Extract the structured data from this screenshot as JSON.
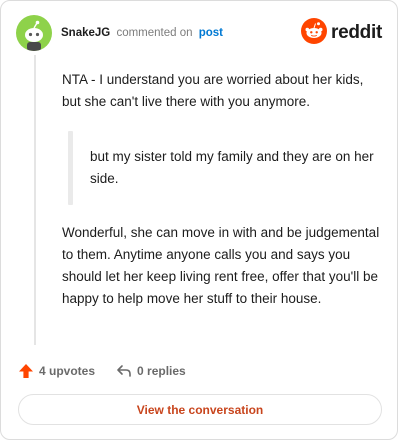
{
  "header": {
    "username": "SnakeJG",
    "action_text": "commented on",
    "post_link": "post",
    "brand_name": "reddit"
  },
  "comment": {
    "paragraph_1": "NTA - I understand you are worried about her kids, but she can't live there with you anymore.",
    "quote": "but my sister told my family and they are on her side.",
    "paragraph_2": "Wonderful, she can move in with and be judgemental to them. Anytime anyone calls you and says you should let her keep living rent free, offer that you'll be happy to help move her stuff to their house."
  },
  "actions": {
    "upvotes_label": "4 upvotes",
    "replies_label": "0 replies"
  },
  "cta_label": "View the conversation",
  "icons": {
    "avatar": "snoo-avatar-icon",
    "brand": "reddit-logo-icon",
    "upvote": "upvote-arrow-icon",
    "reply": "reply-arrow-icon"
  },
  "colors": {
    "brand_orange": "#ff4500",
    "link_blue": "#0079d3",
    "cta_text": "#c8451d",
    "avatar_green": "#8ed24a"
  }
}
